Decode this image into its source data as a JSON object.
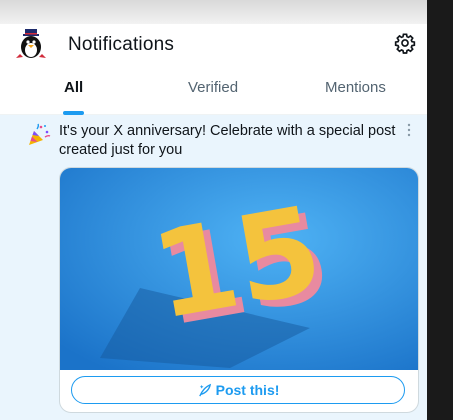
{
  "header": {
    "title": "Notifications",
    "avatar_icon": "penguin-avatar-icon",
    "settings_icon": "gear-icon"
  },
  "tabs": [
    {
      "label": "All",
      "active": true
    },
    {
      "label": "Verified",
      "active": false
    },
    {
      "label": "Mentions",
      "active": false
    }
  ],
  "notification": {
    "icon": "party-popper-icon",
    "text": "It's your X anniversary! Celebrate with a special post created just for you",
    "more_icon": "more-vertical-icon",
    "image_icon": "anniversary-15-image",
    "image_number": "15",
    "button_label": "Post this!",
    "button_icon": "quill-sparkle-icon"
  },
  "colors": {
    "accent": "#1d9bf0",
    "notification_bg": "#eaf5fd",
    "image_bg": "#2a8fd6",
    "number_face": "#f4c33d",
    "number_side": "#e88aa0"
  }
}
